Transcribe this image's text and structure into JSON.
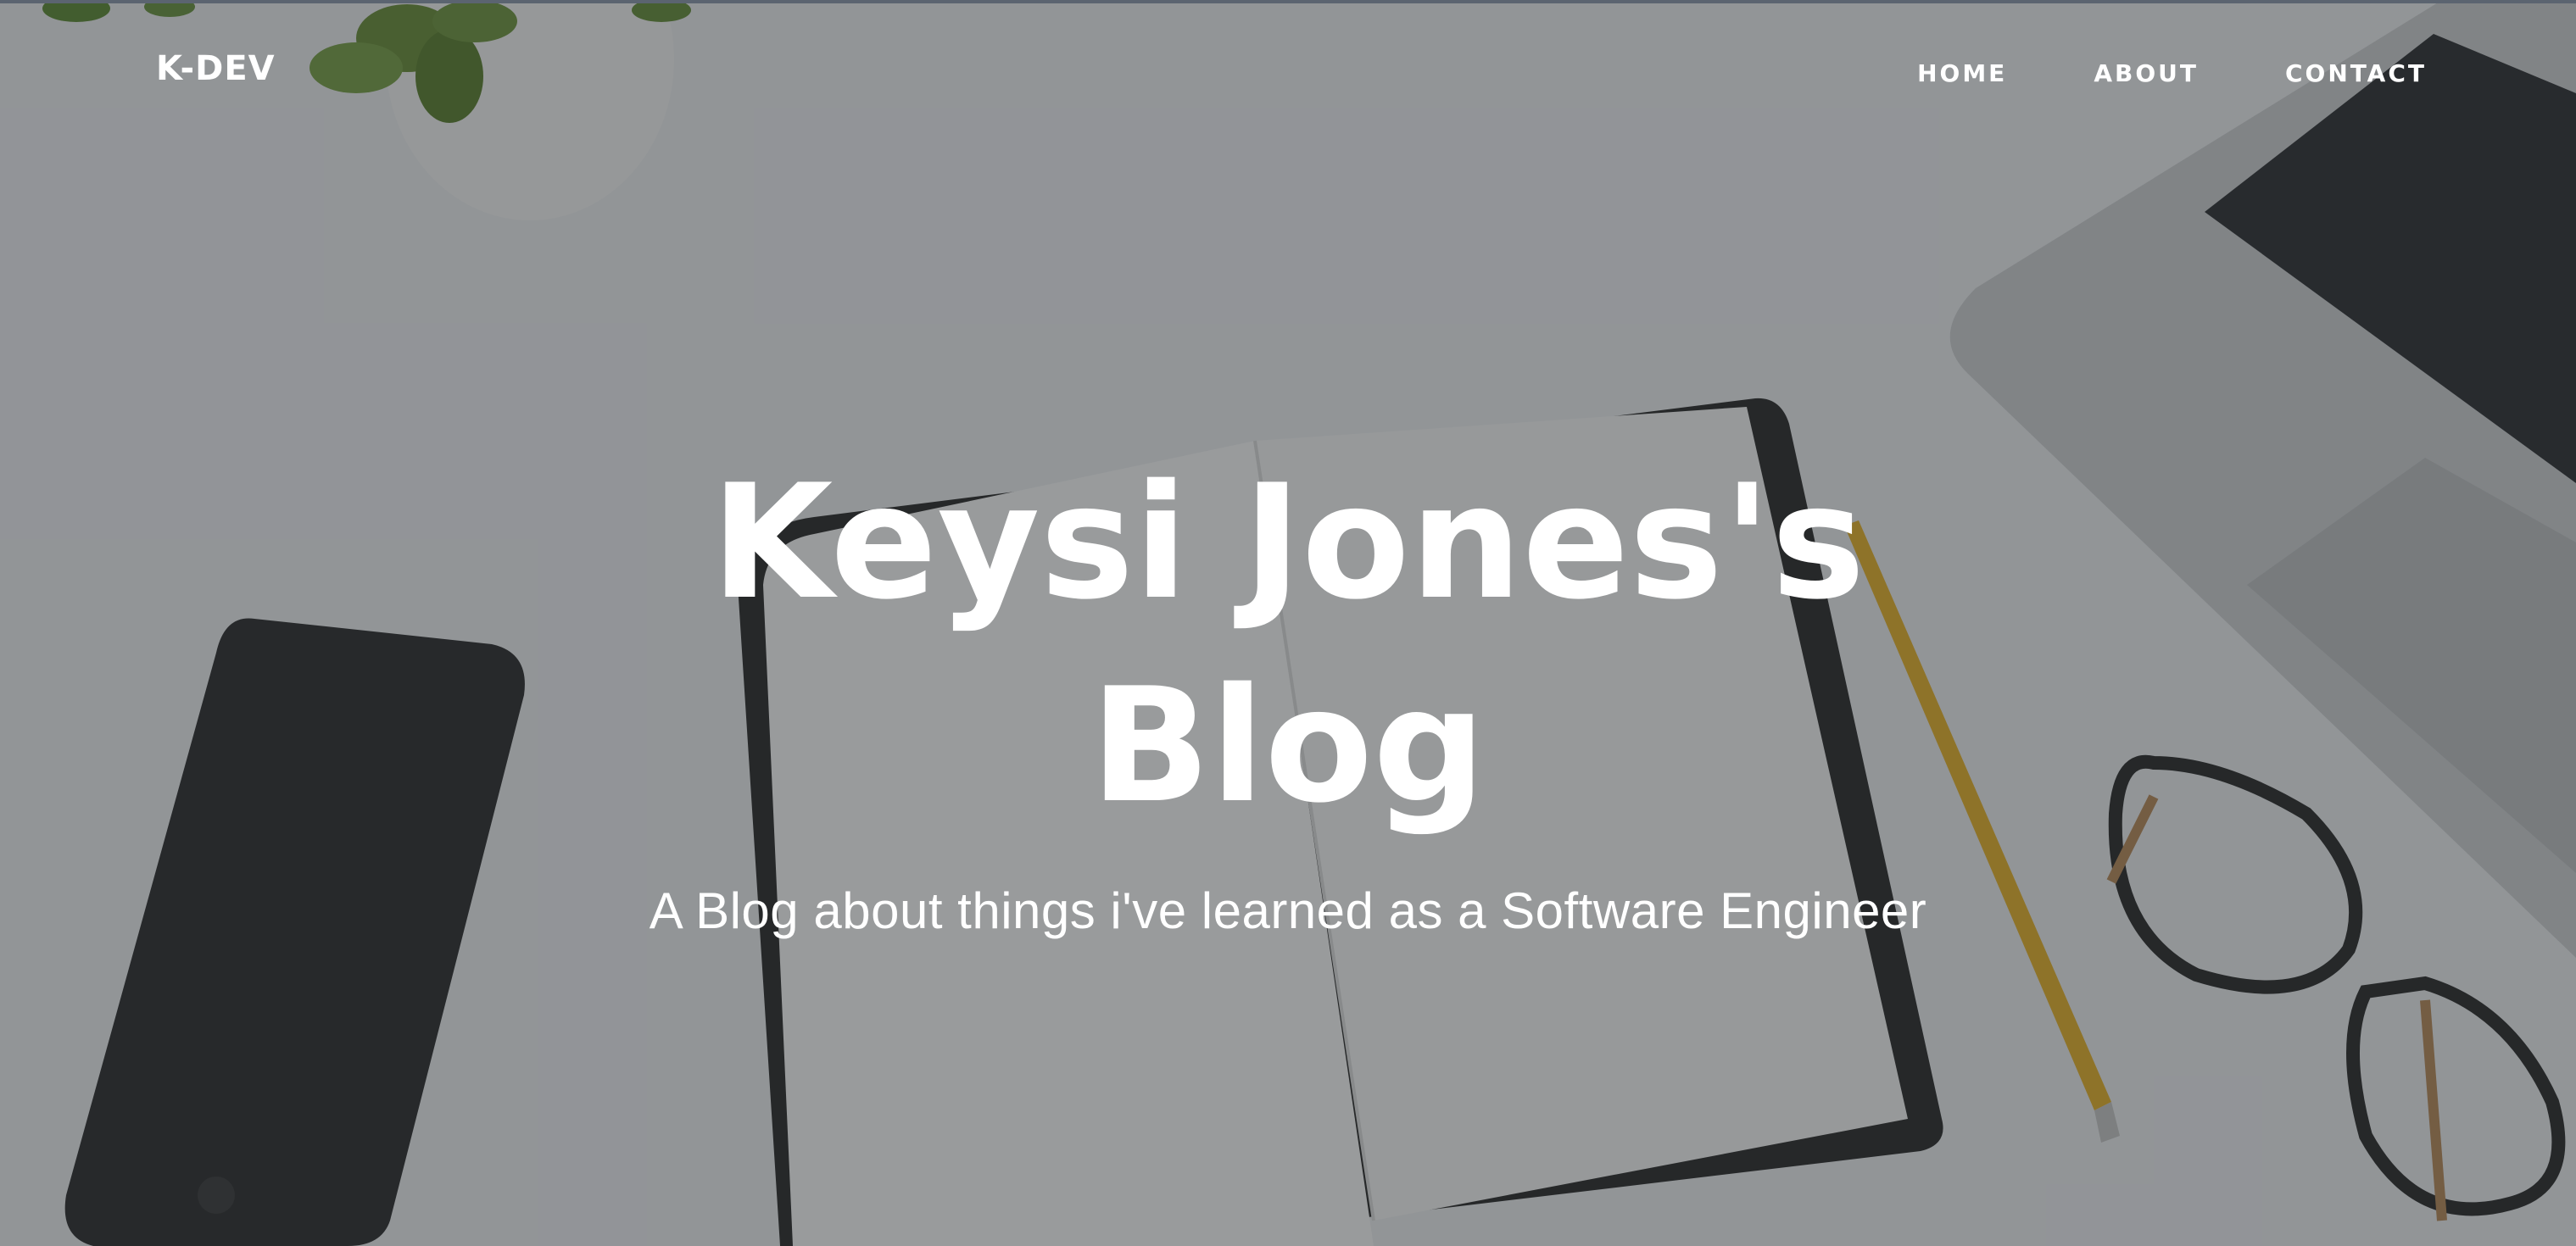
{
  "navbar": {
    "brand": "K-DEV",
    "links": [
      {
        "label": "HOME"
      },
      {
        "label": "ABOUT"
      },
      {
        "label": "CONTACT"
      }
    ]
  },
  "hero": {
    "title_line1": "Keysi Jones's",
    "title_line2": "Blog",
    "subtitle": "A Blog about things i've learned as a Software Engineer"
  },
  "colors": {
    "overlay": "#212529",
    "text": "#ffffff",
    "pencil": "#e8b22a"
  }
}
